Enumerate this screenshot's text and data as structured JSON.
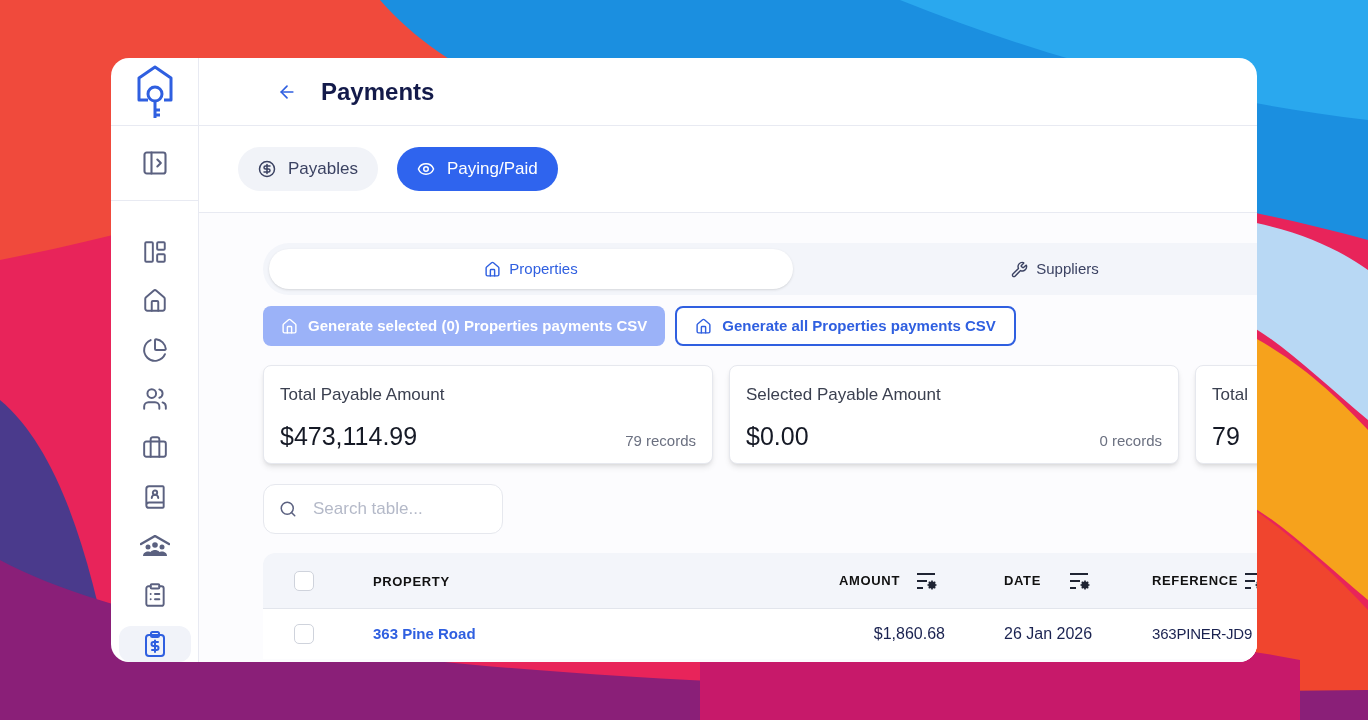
{
  "header": {
    "title": "Payments"
  },
  "sidebar": {
    "items": [
      {
        "selected": false
      },
      {
        "selected": false
      },
      {
        "selected": false
      },
      {
        "selected": false
      },
      {
        "selected": false
      },
      {
        "selected": false
      },
      {
        "selected": false
      },
      {
        "selected": false
      },
      {
        "selected": true
      }
    ]
  },
  "view_tabs": [
    {
      "label": "Payables",
      "selected": false
    },
    {
      "label": "Paying/Paid",
      "selected": true
    }
  ],
  "category_tabs": [
    {
      "label": "Properties",
      "selected": true
    },
    {
      "label": "Suppliers",
      "selected": false
    }
  ],
  "actions": [
    {
      "label": "Generate selected (0) Properties payments CSV",
      "disabled": true
    },
    {
      "label": "Generate all Properties payments CSV",
      "disabled": false
    }
  ],
  "summary_cards": [
    {
      "title": "Total Payable Amount",
      "value": "$473,114.99",
      "records": "79 records"
    },
    {
      "title": "Selected Payable Amount",
      "value": "$0.00",
      "records": "0 records"
    },
    {
      "title": "Total",
      "value": "79"
    }
  ],
  "search": {
    "placeholder": "Search table..."
  },
  "table": {
    "select_all": {
      "checked": false
    },
    "columns": [
      "PROPERTY",
      "AMOUNT",
      "DATE",
      "REFERENCE"
    ],
    "rows": [
      {
        "checked": false,
        "property": "363 Pine Road",
        "amount": "$1,860.68",
        "date": "26 Jan 2026",
        "reference": "363PINER-JD9"
      }
    ]
  }
}
